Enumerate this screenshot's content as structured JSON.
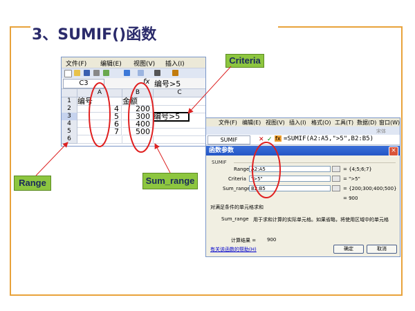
{
  "slide": {
    "title": "3、SUMIF()函数",
    "accent_color": "#e8a23a",
    "title_color": "#2b2b6b"
  },
  "callouts": {
    "criteria": "Criteria",
    "range": "Range",
    "sum_range": "Sum_range",
    "color": "#8dc63f"
  },
  "sheet": {
    "menu": [
      "文件(F)",
      "编辑(E)",
      "视图(V)",
      "插入(I)"
    ],
    "name_box": "C3",
    "fx": "fx",
    "formula": "编号>5",
    "columns": [
      "A",
      "B",
      "C"
    ],
    "rows": [
      {
        "num": "1",
        "a": "编号",
        "b": "金额",
        "c": ""
      },
      {
        "num": "2",
        "a": "4",
        "b": "200",
        "c": ""
      },
      {
        "num": "3",
        "a": "5",
        "b": "300",
        "c": "编号>5"
      },
      {
        "num": "4",
        "a": "6",
        "b": "400",
        "c": ""
      },
      {
        "num": "5",
        "a": "7",
        "b": "500",
        "c": ""
      },
      {
        "num": "6",
        "a": "",
        "b": "",
        "c": ""
      }
    ]
  },
  "dialog_window": {
    "menu": [
      "文件(F)",
      "编辑(E)",
      "视图(V)",
      "插入(I)",
      "格式(O)",
      "工具(T)",
      "数据(D)",
      "窗口(W)"
    ],
    "font_hint": "宋体",
    "name_box": "SUMIF",
    "formula": "=SUMIF(A2:A5,\">5\",B2:B5)",
    "dialog": {
      "title": "函数参数",
      "close": "×",
      "function_name": "SUMIF",
      "args": [
        {
          "label": "Range",
          "value": "A2:A5",
          "result": "= {4;5;6;7}"
        },
        {
          "label": "Criteria",
          "value": "\">5\"",
          "result": "= \">5\""
        },
        {
          "label": "Sum_range",
          "value": "B2:B5",
          "result": "= {200;300;400;500}"
        }
      ],
      "total": "= 900",
      "description": "对满足条件的单元格求和",
      "param_name": "Sum_range",
      "param_desc": "用于求和计算的实际单元格。如果省略，将使用区域中的单元格",
      "result_label": "计算结果 =",
      "result_value": "900",
      "help_link": "有关该函数的帮助(H)",
      "ok": "确定",
      "cancel": "取消"
    }
  }
}
